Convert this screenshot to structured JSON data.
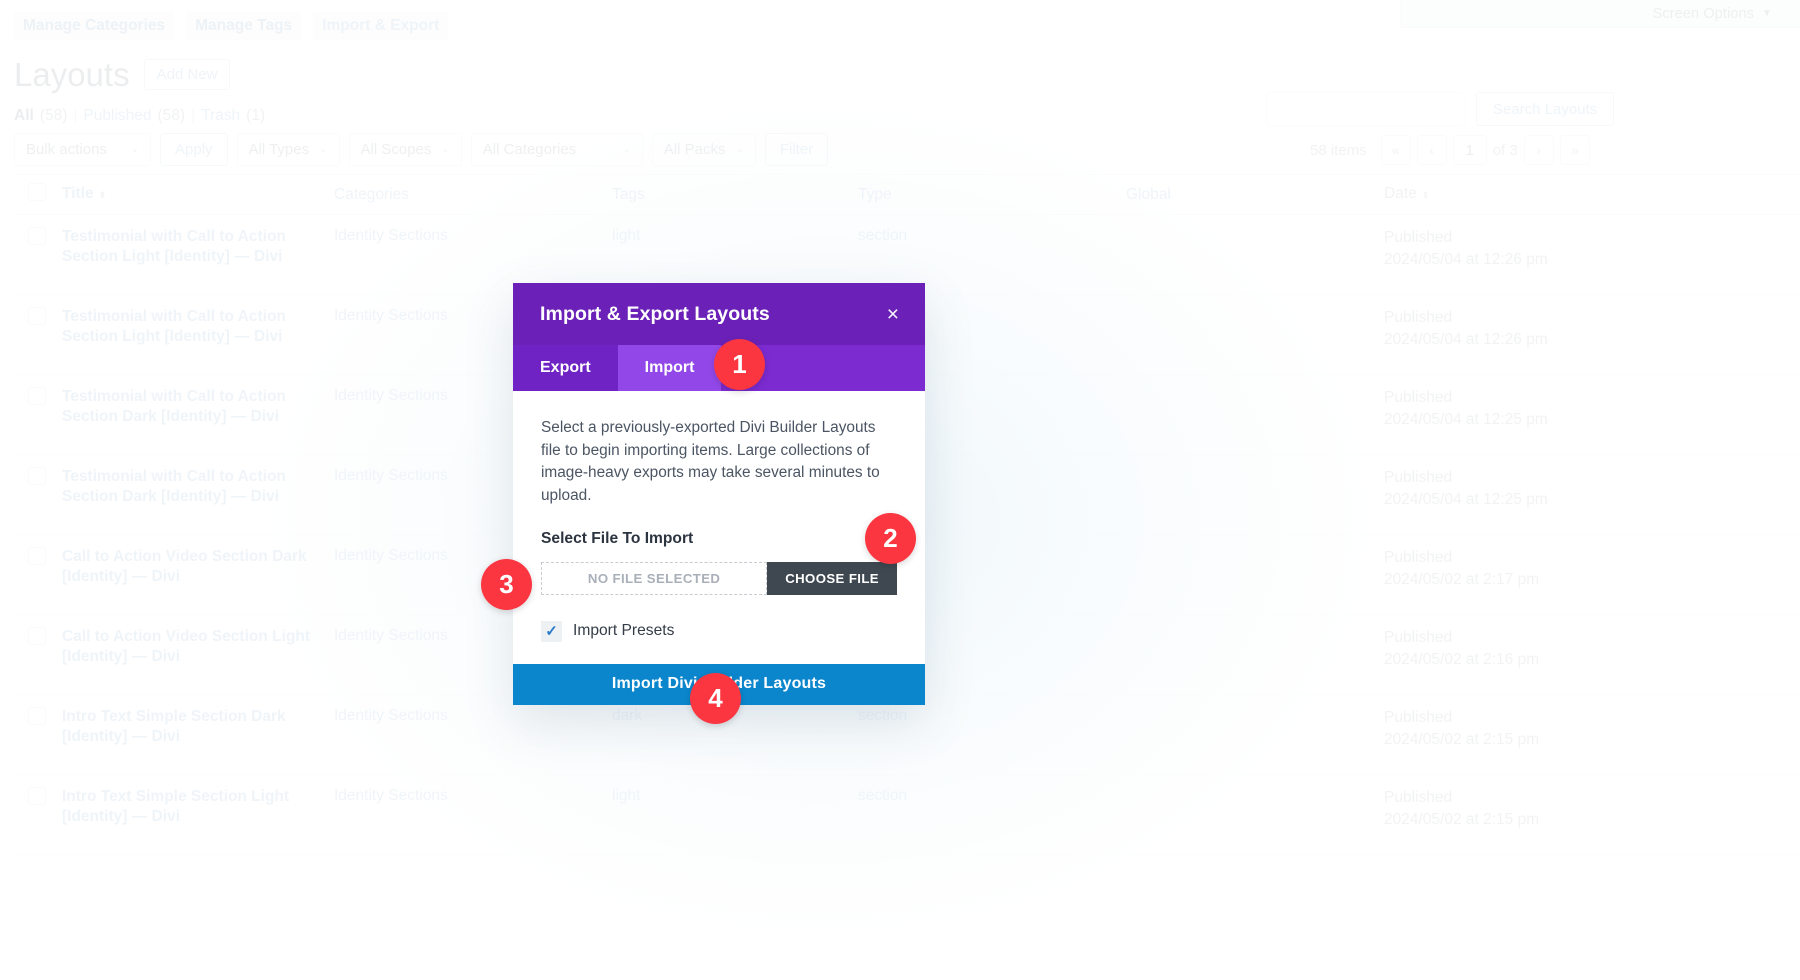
{
  "screen_options": {
    "label": "Screen Options",
    "caret": "▼"
  },
  "subsubnav": [
    {
      "label": "Manage Categories"
    },
    {
      "label": "Manage Tags"
    },
    {
      "label": "Import & Export"
    }
  ],
  "page": {
    "title": "Layouts",
    "add_new_label": "Add New"
  },
  "status_links": {
    "all_label": "All",
    "all_count": "(58)",
    "published_label": "Published",
    "published_count": "(58)",
    "trash_label": "Trash",
    "trash_count": "(1)",
    "separator": "|"
  },
  "search": {
    "value": "",
    "placeholder": "",
    "button_label": "Search Layouts"
  },
  "filters": {
    "bulk_actions": "Bulk actions",
    "apply": "Apply",
    "all_types": "All Types",
    "all_scopes": "All Scopes",
    "all_categories": "All Categories",
    "all_packs": "All Packs",
    "filter": "Filter",
    "arrow": "⌄"
  },
  "pagination": {
    "items_label": "58 items",
    "first": "«",
    "prev": "‹",
    "current_page": "1",
    "of_label": "of 3",
    "next": "›",
    "last": "»"
  },
  "table": {
    "columns": [
      "Title",
      "Categories",
      "Tags",
      "Type",
      "Global",
      "Date"
    ],
    "sort_glyph": "⬍",
    "rows": [
      {
        "title": "Testimonial with Call to Action Section Light [Identity] — Divi",
        "categories": "Identity Sections",
        "tags": "light",
        "type": "section",
        "global": "",
        "status": "Published",
        "date": "2024/05/04 at 12:26 pm"
      },
      {
        "title": "Testimonial with Call to Action Section Light [Identity] — Divi",
        "categories": "Identity Sections",
        "tags": "",
        "type": "",
        "global": "",
        "status": "Published",
        "date": "2024/05/04 at 12:26 pm"
      },
      {
        "title": "Testimonial with Call to Action Section Dark [Identity] — Divi",
        "categories": "Identity Sections",
        "tags": "",
        "type": "",
        "global": "",
        "status": "Published",
        "date": "2024/05/04 at 12:25 pm"
      },
      {
        "title": "Testimonial with Call to Action Section Dark [Identity] — Divi",
        "categories": "Identity Sections",
        "tags": "",
        "type": "",
        "global": "",
        "status": "Published",
        "date": "2024/05/04 at 12:25 pm"
      },
      {
        "title": "Call to Action Video Section Dark [Identity] — Divi",
        "categories": "Identity Sections",
        "tags": "",
        "type": "",
        "global": "",
        "status": "Published",
        "date": "2024/05/02 at 2:17 pm"
      },
      {
        "title": "Call to Action Video Section Light [Identity] — Divi",
        "categories": "Identity Sections",
        "tags": "",
        "type": "",
        "global": "",
        "status": "Published",
        "date": "2024/05/02 at 2:16 pm"
      },
      {
        "title": "Intro Text Simple Section Dark [Identity] — Divi",
        "categories": "Identity Sections",
        "tags": "dark",
        "type": "section",
        "global": "",
        "status": "Published",
        "date": "2024/05/02 at 2:15 pm"
      },
      {
        "title": "Intro Text Simple Section Light [Identity] — Divi",
        "categories": "Identity Sections",
        "tags": "light",
        "type": "section",
        "global": "",
        "status": "Published",
        "date": "2024/05/02 at 2:15 pm"
      }
    ]
  },
  "modal": {
    "title": "Import & Export Layouts",
    "close_glyph": "×",
    "tabs": [
      {
        "label": "Export",
        "active": false
      },
      {
        "label": "Import",
        "active": true
      }
    ],
    "description": "Select a previously-exported Divi Builder Layouts file to begin importing items. Large collections of image-heavy exports may take several minutes to upload.",
    "select_file_label": "Select File To Import",
    "file_name": "No File Selected",
    "choose_file_label": "Choose File",
    "presets_label": "Import Presets",
    "presets_checked": true,
    "presets_check_glyph": "✓",
    "import_button_label": "Import Divi Builder Layouts"
  },
  "badges": [
    {
      "number": "1"
    },
    {
      "number": "2"
    },
    {
      "number": "3"
    },
    {
      "number": "4"
    }
  ],
  "colors": {
    "modal_header_purple": "#6b21b8",
    "modal_tab_purple": "#7b2bd0",
    "modal_tab_active_purple": "#9248e8",
    "choose_file_dark": "#3f4851",
    "import_button_blue": "#0b86cd",
    "badge_red": "#fb3640",
    "link_blue": "#4f8fc0",
    "check_blue": "#2b7bca"
  }
}
